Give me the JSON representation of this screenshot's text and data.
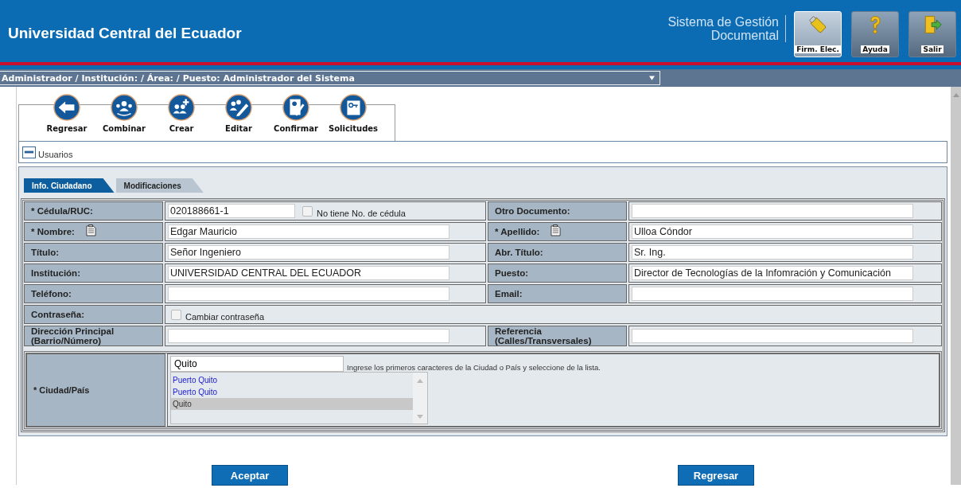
{
  "header": {
    "title": "Universidad Central del Ecuador",
    "system_name": [
      "Sistema de Gestión",
      "Documental"
    ],
    "buttons": [
      {
        "label": "Firm. Elec.",
        "kind": "signature",
        "selected": true
      },
      {
        "label": "Ayuda",
        "kind": "help",
        "selected": false
      },
      {
        "label": "Salir",
        "kind": "exit",
        "selected": false
      }
    ]
  },
  "role_selector": {
    "value": "Administrador / Institución: / Área: / Puesto: Administrador del Sistema"
  },
  "toolbar": [
    {
      "label": "Regresar",
      "kind": "back"
    },
    {
      "label": "Combinar",
      "kind": "merge"
    },
    {
      "label": "Crear",
      "kind": "create"
    },
    {
      "label": "Editar",
      "kind": "edit"
    },
    {
      "label": "Confirmar",
      "kind": "confirm"
    },
    {
      "label": "Solicitudes",
      "kind": "requests"
    }
  ],
  "panel": {
    "title": "Usuarios",
    "expanded": true
  },
  "tabs": [
    {
      "label": "Info. Ciudadano",
      "selected": true
    },
    {
      "label": "Modificaciones",
      "selected": false
    }
  ],
  "form_rows": [
    {
      "fields": [
        {
          "label": "* Cédula/RUC:",
          "copy_icon": false,
          "kind": "text_checkbox",
          "value": "020188661-1",
          "checkbox_label": "No tiene No. de cédula",
          "checked": false
        },
        {
          "label": "Otro Documento:",
          "copy_icon": false,
          "kind": "text"
        }
      ]
    },
    {
      "fields": [
        {
          "label": "* Nombre:",
          "copy_icon": true,
          "kind": "text",
          "value": "Edgar Mauricio"
        },
        {
          "label": "* Apellido:",
          "copy_icon": true,
          "kind": "text",
          "value": "Ulloa Cóndor"
        }
      ]
    },
    {
      "fields": [
        {
          "label": "Título:",
          "copy_icon": false,
          "kind": "text",
          "value": "Señor Ingeniero"
        },
        {
          "label": "Abr. Título:",
          "copy_icon": false,
          "kind": "text",
          "value": "Sr. Ing."
        }
      ]
    },
    {
      "fields": [
        {
          "label": "Institución:",
          "copy_icon": false,
          "kind": "text",
          "value": "UNIVERSIDAD CENTRAL DEL ECUADOR"
        },
        {
          "label": "Puesto:",
          "copy_icon": false,
          "kind": "text",
          "value": "Director de Tecnologías de la Infomración y Comunicación"
        }
      ]
    },
    {
      "fields": [
        {
          "label": "Teléfono:",
          "copy_icon": false,
          "kind": "text"
        },
        {
          "label": "Email:",
          "copy_icon": false,
          "kind": "text"
        }
      ]
    },
    {
      "fields": [
        {
          "label": "Contraseña:",
          "copy_icon": false,
          "kind": "checkbox",
          "checkbox_label": "Cambiar contraseña",
          "checked": false
        }
      ]
    },
    {
      "fields": [
        {
          "label": "Dirección Principal\n(Barrio/Número)",
          "copy_icon": false,
          "kind": "text"
        },
        {
          "label": "Referencia\n(Calles/Transversales)",
          "copy_icon": false,
          "kind": "text"
        }
      ]
    }
  ],
  "city": {
    "label": "* Ciudad/País",
    "value": "Quito",
    "hint": "Ingrese los primeros caracteres de la Ciudad o País y seleccione de la lista.",
    "options": [
      {
        "label": "Puerto Quito",
        "selected": false
      },
      {
        "label": "Puerto Quito",
        "selected": false
      },
      {
        "label": "Quito",
        "selected": true
      }
    ]
  },
  "buttons": [
    {
      "label": "Aceptar"
    },
    {
      "label": "Regresar"
    }
  ]
}
